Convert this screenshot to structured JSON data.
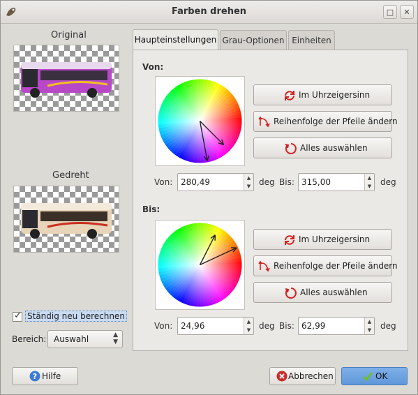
{
  "window": {
    "title": "Farben drehen"
  },
  "side": {
    "original_label": "Original",
    "rotated_label": "Gedreht",
    "recompute_label": "Ständig neu berechnen",
    "recompute_checked": true,
    "range_label": "Bereich:",
    "range_value": "Auswahl"
  },
  "tabs": [
    "Haupteinstellungen",
    "Grau-Optionen",
    "Einheiten"
  ],
  "from": {
    "section": "Von:",
    "buttons": {
      "clockwise": "Im Uhrzeigersinn",
      "swap": "Reihenfolge der Pfeile ändern",
      "select_all": "Alles auswählen"
    },
    "from_label": "Von:",
    "from_value": "280,49",
    "unit1": "deg",
    "to_label": "Bis:",
    "to_value": "315,00",
    "unit2": "deg"
  },
  "to": {
    "section": "Bis:",
    "buttons": {
      "clockwise": "Im Uhrzeigersinn",
      "swap": "Reihenfolge der Pfeile ändern",
      "select_all": "Alles auswählen"
    },
    "from_label": "Von:",
    "from_value": "24,96",
    "unit1": "deg",
    "to_label": "Bis:",
    "to_value": "62,99",
    "unit2": "deg"
  },
  "footer": {
    "help": "Hilfe",
    "cancel": "Abbrechen",
    "ok": "OK"
  },
  "colors": {
    "accent": "#5e97d9",
    "arrow_icon": "#d42020"
  }
}
